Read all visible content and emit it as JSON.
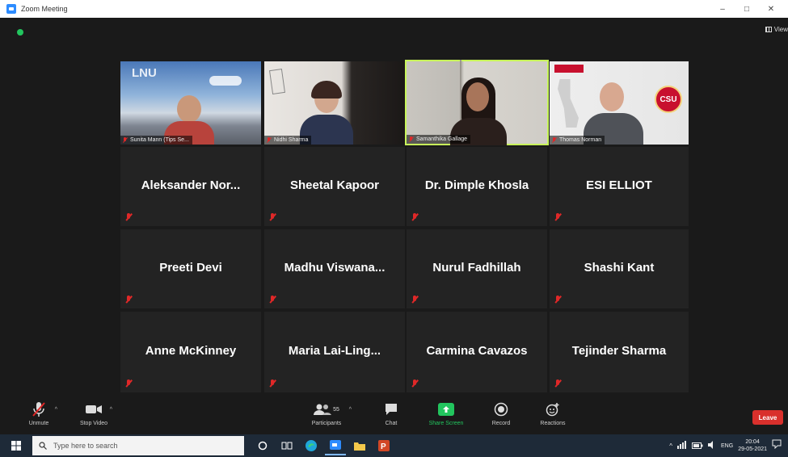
{
  "window": {
    "title": "Zoom Meeting",
    "controls": [
      "–",
      "□",
      "✕"
    ]
  },
  "meeting": {
    "view_label": "View"
  },
  "video_tiles": [
    {
      "name": "Sunita Mann (Tips Se..."
    },
    {
      "name": "Nidhi Sharma"
    },
    {
      "name": "Samanthika Gallage"
    },
    {
      "name": "Thomas Norman"
    }
  ],
  "video_overlay_text": {
    "lnu_logo": "LNU",
    "csu_logo": "CSU"
  },
  "name_tiles": [
    "Aleksander  Nor...",
    "Sheetal Kapoor",
    "Dr. Dimple Khosla",
    "ESI ELLIOT",
    "Preeti Devi",
    "Madhu  Viswana...",
    "Nurul Fadhillah",
    "Shashi Kant",
    "Anne McKinney",
    "Maria  Lai-Ling...",
    "Carmina Cavazos",
    "Tejinder Sharma"
  ],
  "toolbar": {
    "unmute": "Unmute",
    "start_video": "Stop Video",
    "participants": "Participants",
    "participant_count": "55",
    "chat": "Chat",
    "share_screen": "Share Screen",
    "record": "Record",
    "reactions": "Reactions",
    "leave": "Leave"
  },
  "taskbar": {
    "search_placeholder": "Type here to search",
    "language": "ENG",
    "time": "20:04",
    "date": "29-05-2021"
  },
  "colors": {
    "active_speaker_border": "#c8f55a",
    "leave": "#d9302c",
    "muted_icon": "#e02828"
  }
}
